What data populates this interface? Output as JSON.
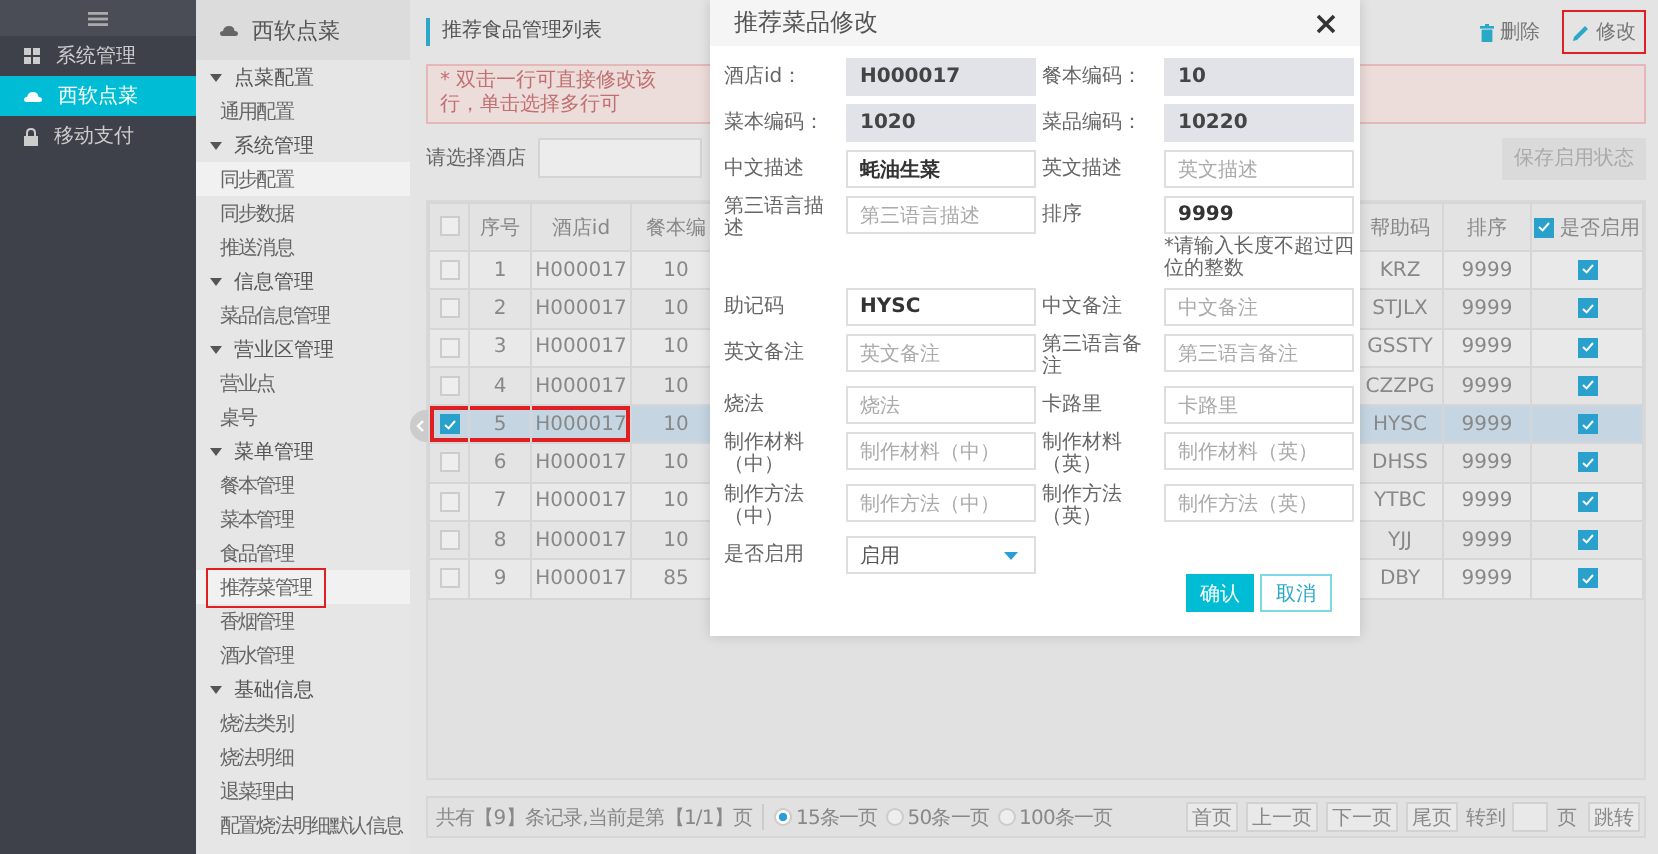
{
  "nav": {
    "items": [
      {
        "label": "系统管理",
        "selected": false
      },
      {
        "label": "西软点菜",
        "selected": true
      },
      {
        "label": "移动支付",
        "selected": false
      }
    ]
  },
  "sidebar": {
    "title": "西软点菜",
    "groups": [
      {
        "label": "点菜配置",
        "expanded": true,
        "children": [
          {
            "label": "通用配置",
            "selected": false,
            "highlighted": false
          }
        ]
      },
      {
        "label": "系统管理",
        "expanded": true,
        "children": [
          {
            "label": "同步配置",
            "selected": true,
            "highlighted": false
          },
          {
            "label": "同步数据",
            "selected": false,
            "highlighted": false
          },
          {
            "label": "推送消息",
            "selected": false,
            "highlighted": false
          }
        ]
      },
      {
        "label": "信息管理",
        "expanded": true,
        "children": [
          {
            "label": "菜品信息管理",
            "selected": false,
            "highlighted": false
          }
        ]
      },
      {
        "label": "营业区管理",
        "expanded": true,
        "children": [
          {
            "label": "营业点",
            "selected": false,
            "highlighted": false
          },
          {
            "label": "桌号",
            "selected": false,
            "highlighted": false
          }
        ]
      },
      {
        "label": "菜单管理",
        "expanded": true,
        "children": [
          {
            "label": "餐本管理",
            "selected": false,
            "highlighted": false
          },
          {
            "label": "菜本管理",
            "selected": false,
            "highlighted": false
          },
          {
            "label": "食品管理",
            "selected": false,
            "highlighted": false
          },
          {
            "label": "推荐菜管理",
            "selected": true,
            "highlighted": true
          },
          {
            "label": "香烟管理",
            "selected": false,
            "highlighted": false
          },
          {
            "label": "酒水管理",
            "selected": false,
            "highlighted": false
          }
        ]
      },
      {
        "label": "基础信息",
        "expanded": true,
        "children": [
          {
            "label": "烧法类别",
            "selected": false,
            "highlighted": false
          },
          {
            "label": "烧法明细",
            "selected": false,
            "highlighted": false
          },
          {
            "label": "退菜理由",
            "selected": false,
            "highlighted": false
          },
          {
            "label": "配置烧法明细默认信息",
            "selected": false,
            "highlighted": false
          }
        ]
      }
    ]
  },
  "toolbar": {
    "title": "推荐食品管理列表",
    "buttons": [
      {
        "label": "删除",
        "highlighted": false
      },
      {
        "label": "修改",
        "highlighted": true
      }
    ]
  },
  "notice": "* 双击一行可直接修改该行，单击选择多行可",
  "filter": {
    "label": "请选择酒店",
    "save_button": {
      "label": "保存启用状态",
      "disabled": true
    }
  },
  "table": {
    "select_all_checked": false,
    "enabled_all_checked": true,
    "columns": [
      "序号",
      "酒店id",
      "餐本编",
      "帮助码",
      "排序",
      "是否启用"
    ],
    "rows": [
      {
        "index": "1",
        "hotel_id": "H000017",
        "menu_code": "10",
        "help_code": "KRZ",
        "sort": "9999",
        "enabled": true,
        "selected": false,
        "highlighted": false
      },
      {
        "index": "2",
        "hotel_id": "H000017",
        "menu_code": "10",
        "help_code": "STJLX",
        "sort": "9999",
        "enabled": true,
        "selected": false,
        "highlighted": false
      },
      {
        "index": "3",
        "hotel_id": "H000017",
        "menu_code": "10",
        "help_code": "GSSTY",
        "sort": "9999",
        "enabled": true,
        "selected": false,
        "highlighted": false
      },
      {
        "index": "4",
        "hotel_id": "H000017",
        "menu_code": "10",
        "help_code": "CZZPG",
        "sort": "9999",
        "enabled": true,
        "selected": false,
        "highlighted": false
      },
      {
        "index": "5",
        "hotel_id": "H000017",
        "menu_code": "10",
        "help_code": "HYSC",
        "sort": "9999",
        "enabled": true,
        "selected": true,
        "highlighted": true
      },
      {
        "index": "6",
        "hotel_id": "H000017",
        "menu_code": "10",
        "help_code": "DHSS",
        "sort": "9999",
        "enabled": true,
        "selected": false,
        "highlighted": false
      },
      {
        "index": "7",
        "hotel_id": "H000017",
        "menu_code": "10",
        "help_code": "YTBC",
        "sort": "9999",
        "enabled": true,
        "selected": false,
        "highlighted": false
      },
      {
        "index": "8",
        "hotel_id": "H000017",
        "menu_code": "10",
        "help_code": "YJJ",
        "sort": "9999",
        "enabled": true,
        "selected": false,
        "highlighted": false
      },
      {
        "index": "9",
        "hotel_id": "H000017",
        "menu_code": "85",
        "help_code": "DBY",
        "sort": "9999",
        "enabled": true,
        "selected": false,
        "highlighted": false
      }
    ]
  },
  "pagination": {
    "summary": "共有【9】条记录,当前是第【1/1】页",
    "page_sizes": [
      {
        "label": "15条一页",
        "selected": true
      },
      {
        "label": "50条一页",
        "selected": false
      },
      {
        "label": "100条一页",
        "selected": false
      }
    ],
    "buttons": [
      "首页",
      "上一页",
      "下一页",
      "尾页"
    ],
    "goto_label": "转到",
    "page_unit": "页",
    "jump": "跳转"
  },
  "modal": {
    "title": "推荐菜品修改",
    "fields": [
      {
        "label": "酒店id：",
        "kind": "readonly",
        "value": "H000017"
      },
      {
        "label": "餐本编码：",
        "kind": "readonly",
        "value": "10"
      },
      {
        "label": "菜本编码：",
        "kind": "readonly",
        "value": "1020"
      },
      {
        "label": "菜品编码：",
        "kind": "readonly",
        "value": "10220"
      },
      {
        "label": "中文描述",
        "kind": "input",
        "value": "蚝油生菜"
      },
      {
        "label": "英文描述",
        "kind": "input",
        "placeholder": "英文描述"
      },
      {
        "label": "第三语言描述",
        "kind": "input",
        "placeholder": "第三语言描述"
      },
      {
        "label": "排序",
        "kind": "input",
        "value": "9999",
        "hint": "*请输入长度不超过四位的整数"
      },
      {
        "label": "助记码",
        "kind": "input",
        "value": "HYSC"
      },
      {
        "label": "中文备注",
        "kind": "input",
        "placeholder": "中文备注"
      },
      {
        "label": "英文备注",
        "kind": "input",
        "placeholder": "英文备注"
      },
      {
        "label": "第三语言备注",
        "kind": "input",
        "placeholder": "第三语言备注"
      },
      {
        "label": "烧法",
        "kind": "input",
        "placeholder": "烧法"
      },
      {
        "label": "卡路里",
        "kind": "input",
        "placeholder": "卡路里"
      },
      {
        "label": "制作材料（中）",
        "kind": "input",
        "placeholder": "制作材料（中）"
      },
      {
        "label": "制作材料（英）",
        "kind": "input",
        "placeholder": "制作材料（英）"
      },
      {
        "label": "制作方法（中）",
        "kind": "input",
        "placeholder": "制作方法（中）"
      },
      {
        "label": "制作方法（英）",
        "kind": "input",
        "placeholder": "制作方法（英）"
      },
      {
        "label": "是否启用",
        "kind": "select",
        "value": "启用"
      }
    ],
    "confirm": "确认",
    "cancel": "取消"
  }
}
